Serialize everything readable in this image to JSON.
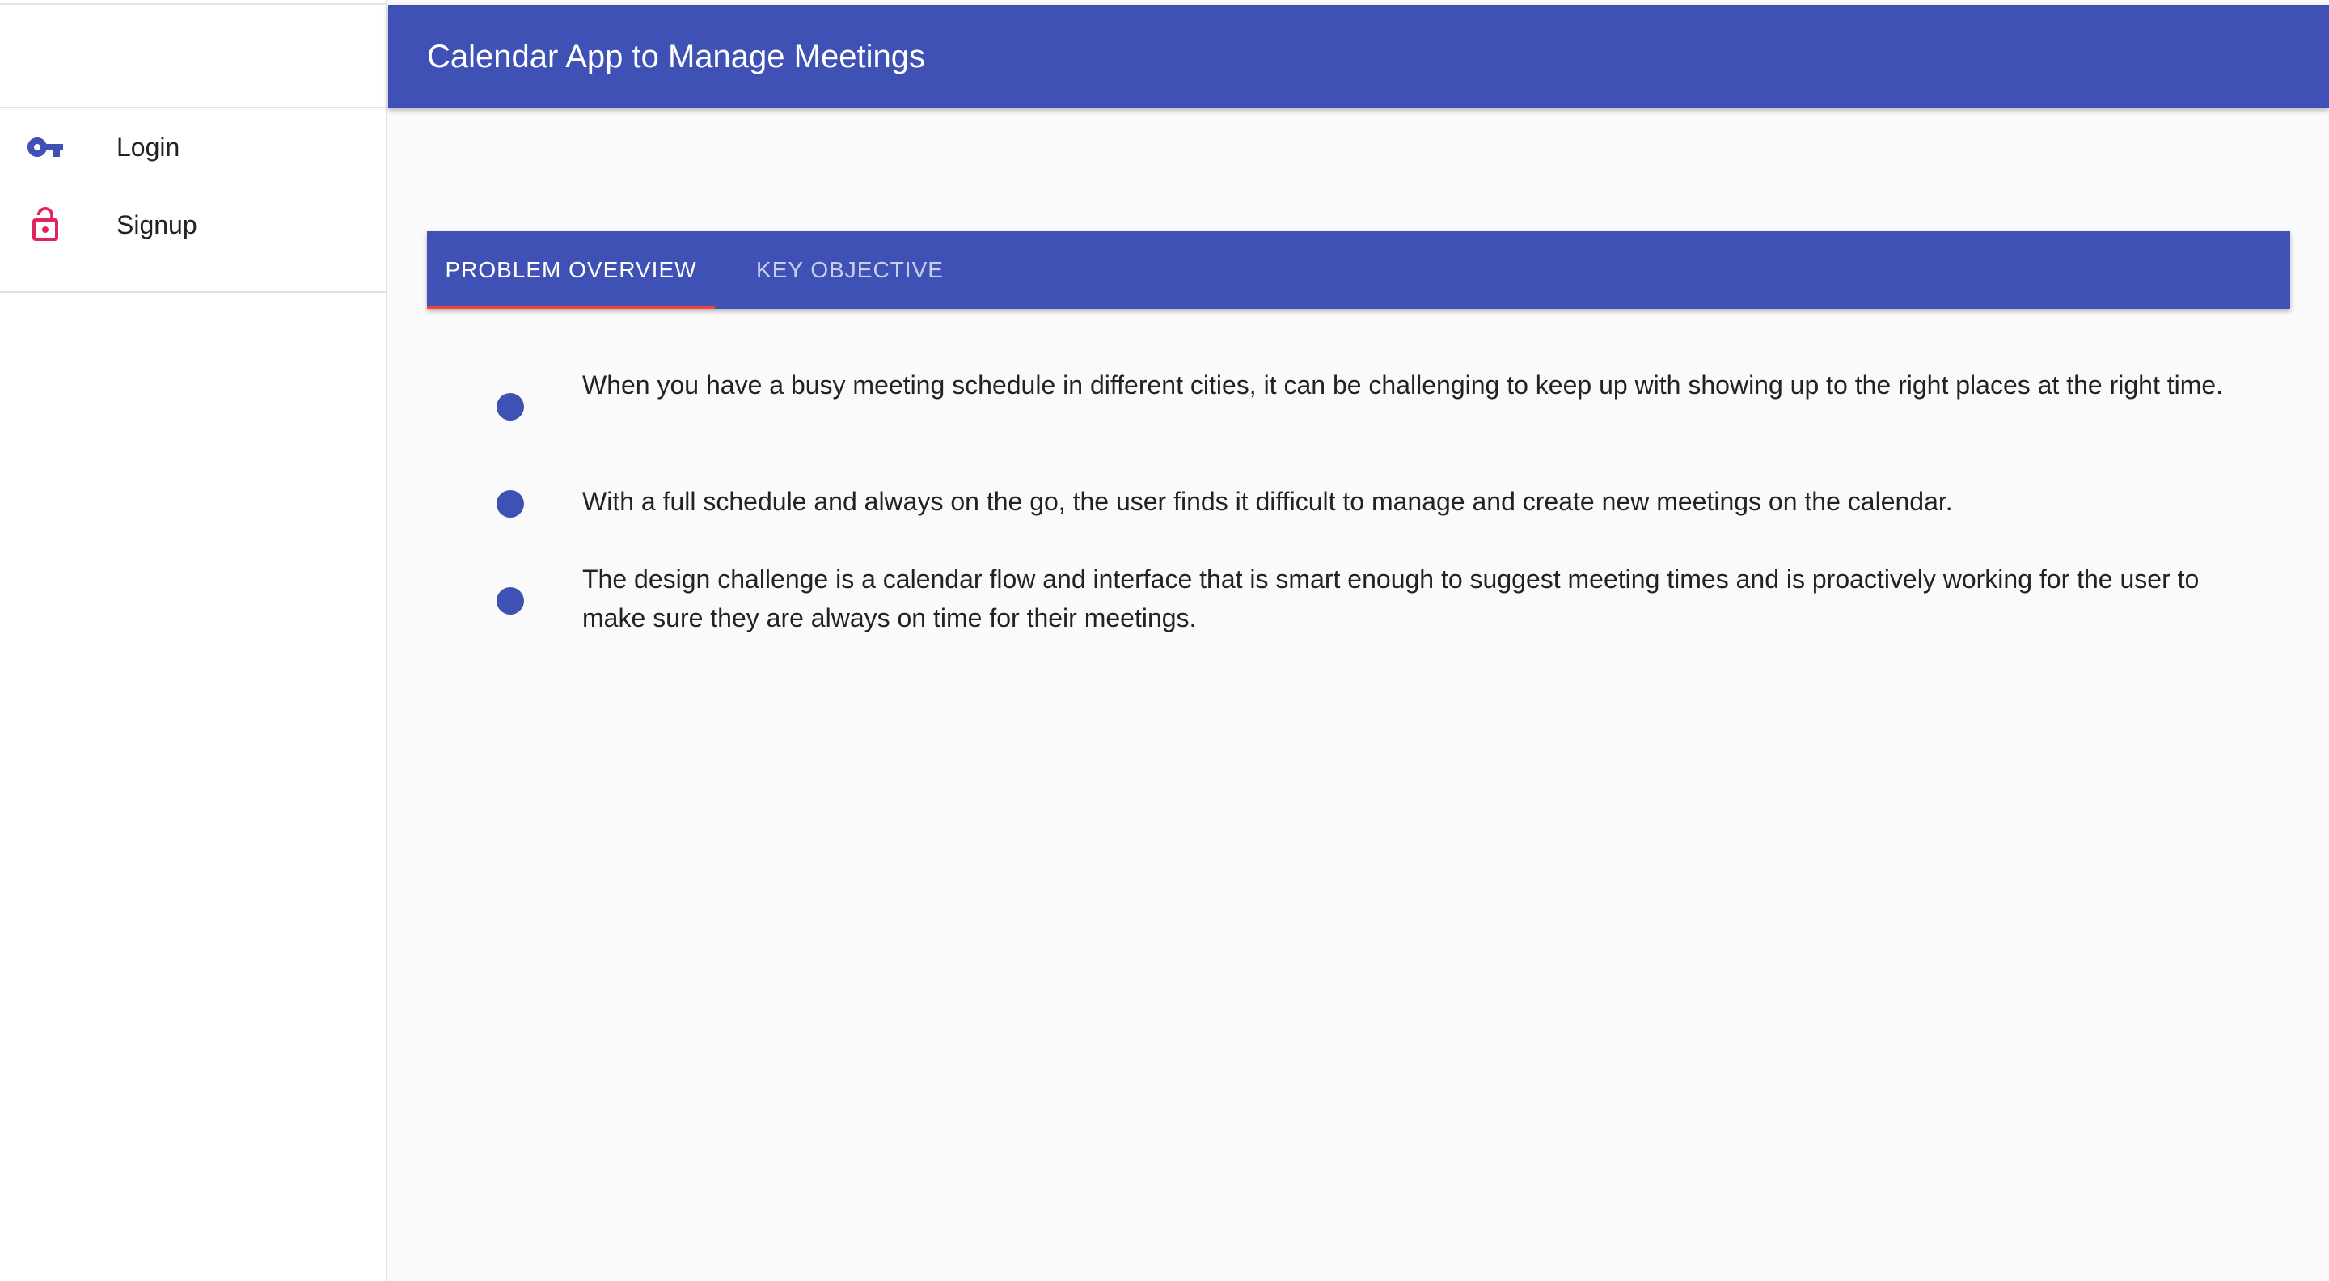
{
  "app_title": "Calendar App to Manage Meetings",
  "sidebar": {
    "items": [
      {
        "label": "Login",
        "icon": "key-icon",
        "icon_color": "#3f51b5"
      },
      {
        "label": "Signup",
        "icon": "lock-open-icon",
        "icon_color": "#e0245e"
      }
    ]
  },
  "tabs": [
    {
      "label": "PROBLEM OVERVIEW",
      "active": true
    },
    {
      "label": "KEY OBJECTIVE",
      "active": false
    }
  ],
  "problem_overview": {
    "items": [
      "When you have a busy meeting schedule in different cities, it can be challenging to keep up with showing up to the right places at the right time.",
      "With a full schedule and always on the go, the user finds it difficult to manage and create new meetings on the calendar.",
      "The design challenge is a calendar flow and interface that is smart enough to suggest meeting times and is proactively working for the user to make sure they are always on time for their meetings."
    ]
  },
  "colors": {
    "primary": "#3f51b5",
    "accent": "#f44336",
    "signup_icon": "#e0245e",
    "background": "#fafafa"
  }
}
